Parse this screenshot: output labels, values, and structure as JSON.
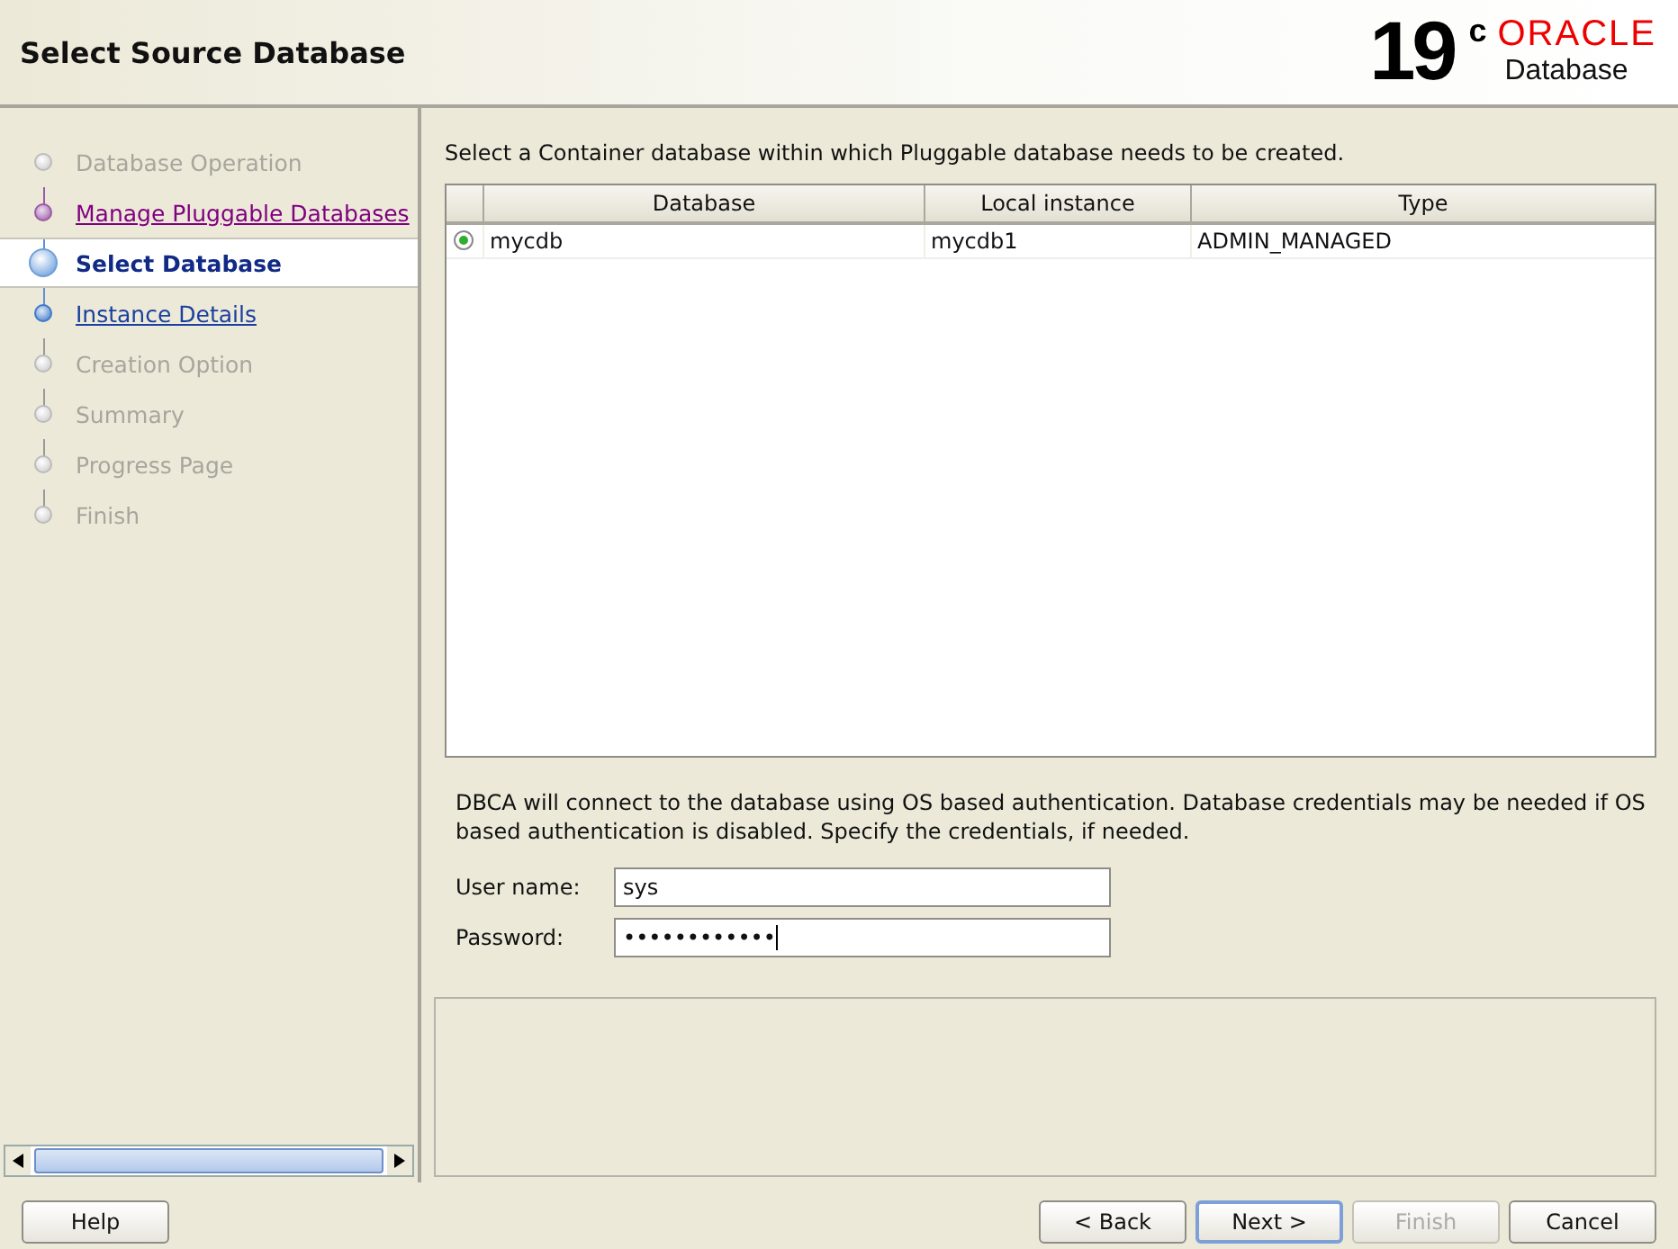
{
  "header": {
    "title": "Select Source Database",
    "logo": {
      "version": "19",
      "superscript": "c",
      "brand": "ORACLE",
      "product": "Database"
    }
  },
  "steps": [
    {
      "label": "Database Operation",
      "disabled": true,
      "visited": false,
      "selected": false
    },
    {
      "label": "Manage Pluggable Databases",
      "disabled": false,
      "visited": true,
      "selected": false
    },
    {
      "label": "Select Database",
      "disabled": false,
      "visited": false,
      "selected": true
    },
    {
      "label": "Instance Details",
      "disabled": false,
      "visited": false,
      "selected": false
    },
    {
      "label": "Creation Option",
      "disabled": true,
      "visited": false,
      "selected": false
    },
    {
      "label": "Summary",
      "disabled": true,
      "visited": false,
      "selected": false
    },
    {
      "label": "Progress Page",
      "disabled": true,
      "visited": false,
      "selected": false
    },
    {
      "label": "Finish",
      "disabled": true,
      "visited": false,
      "selected": false
    }
  ],
  "instruction": "Select a Container database within which Pluggable database needs to be created.",
  "table": {
    "columns": [
      "Database",
      "Local instance",
      "Type"
    ],
    "rows": [
      {
        "selected": true,
        "cells": [
          "mycdb",
          "mycdb1",
          "ADMIN_MANAGED"
        ]
      }
    ]
  },
  "note": "DBCA will connect to the database using OS based authentication. Database credentials may be needed if OS based authentication is disabled. Specify the credentials, if needed.",
  "fields": [
    {
      "label": "User name:",
      "value": "sys",
      "kind": "text"
    },
    {
      "label": "Password:",
      "value": "••••••••••••",
      "kind": "password"
    }
  ],
  "help_button": {
    "label": "Help"
  },
  "nav_buttons": [
    {
      "label": "< Back",
      "disabled": false,
      "default": false
    },
    {
      "label": "Next >",
      "disabled": false,
      "default": true
    },
    {
      "label": "Finish",
      "disabled": true,
      "default": false
    },
    {
      "label": "Cancel",
      "disabled": false,
      "default": false
    }
  ]
}
